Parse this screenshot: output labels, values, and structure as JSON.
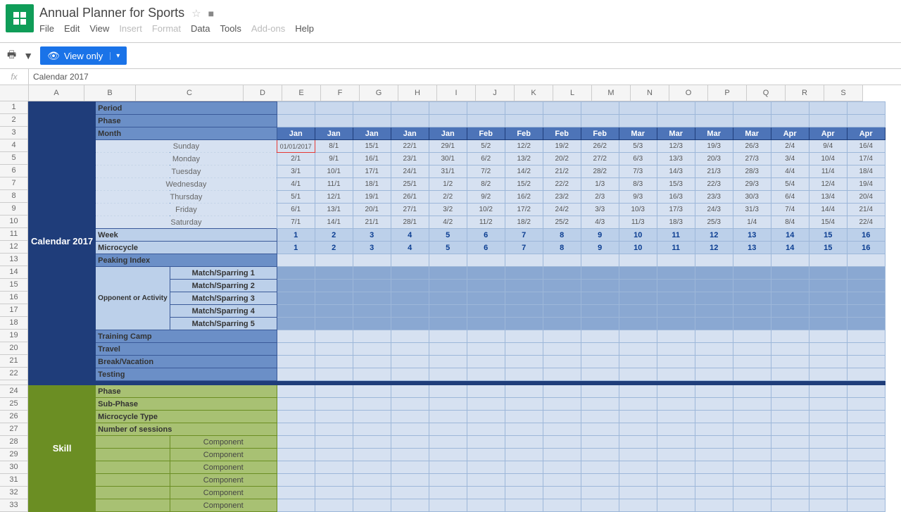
{
  "doc": {
    "title": "Annual Planner for Sports"
  },
  "menus": {
    "file": "File",
    "edit": "Edit",
    "view": "View",
    "insert": "Insert",
    "format": "Format",
    "data": "Data",
    "tools": "Tools",
    "addons": "Add-ons",
    "help": "Help"
  },
  "toolbar": {
    "view_only": "View only"
  },
  "fx": {
    "value": "Calendar 2017"
  },
  "cols": [
    "A",
    "B",
    "C",
    "D",
    "E",
    "F",
    "G",
    "H",
    "I",
    "J",
    "K",
    "L",
    "M",
    "N",
    "O",
    "P",
    "Q",
    "R",
    "S"
  ],
  "colWidths": [
    "wA",
    "wB",
    "wC",
    "wD",
    "wD",
    "wD",
    "wD",
    "wD",
    "wD",
    "wD",
    "wD",
    "wD",
    "wD",
    "wD",
    "wD",
    "wD",
    "wD",
    "wD",
    "wD"
  ],
  "rows": [
    "1",
    "2",
    "3",
    "4",
    "5",
    "6",
    "7",
    "8",
    "9",
    "10",
    "11",
    "12",
    "13",
    "14",
    "15",
    "16",
    "17",
    "18",
    "19",
    "20",
    "21",
    "22",
    "",
    "24",
    "25",
    "26",
    "27",
    "28",
    "29",
    "30",
    "31",
    "32",
    "33"
  ],
  "labels": {
    "calendar": "Calendar 2017",
    "period": "Period",
    "phase": "Phase",
    "month": "Month",
    "days": [
      "Sunday",
      "Monday",
      "Tuesday",
      "Wednesday",
      "Thursday",
      "Friday",
      "Saturday"
    ],
    "week": "Week",
    "microcycle": "Microcycle",
    "peaking": "Peaking Index",
    "opponent": "Opponent or Activity",
    "matches": [
      "Match/Sparring 1",
      "Match/Sparring 2",
      "Match/Sparring 3",
      "Match/Sparring 4",
      "Match/Sparring 5"
    ],
    "training": "Training Camp",
    "travel": "Travel",
    "break": "Break/Vacation",
    "testing": "Testing",
    "skill": "Skill",
    "subphase": "Sub-Phase",
    "microtype": "Microcycle Type",
    "sessions": "Number of sessions",
    "component": "Component"
  },
  "months": [
    "Jan",
    "Jan",
    "Jan",
    "Jan",
    "Jan",
    "Feb",
    "Feb",
    "Feb",
    "Feb",
    "Mar",
    "Mar",
    "Mar",
    "Mar",
    "Apr",
    "Apr",
    "Apr"
  ],
  "dates": [
    [
      "01/01/2017",
      "8/1",
      "15/1",
      "22/1",
      "29/1",
      "5/2",
      "12/2",
      "19/2",
      "26/2",
      "5/3",
      "12/3",
      "19/3",
      "26/3",
      "2/4",
      "9/4",
      "16/4"
    ],
    [
      "2/1",
      "9/1",
      "16/1",
      "23/1",
      "30/1",
      "6/2",
      "13/2",
      "20/2",
      "27/2",
      "6/3",
      "13/3",
      "20/3",
      "27/3",
      "3/4",
      "10/4",
      "17/4"
    ],
    [
      "3/1",
      "10/1",
      "17/1",
      "24/1",
      "31/1",
      "7/2",
      "14/2",
      "21/2",
      "28/2",
      "7/3",
      "14/3",
      "21/3",
      "28/3",
      "4/4",
      "11/4",
      "18/4"
    ],
    [
      "4/1",
      "11/1",
      "18/1",
      "25/1",
      "1/2",
      "8/2",
      "15/2",
      "22/2",
      "1/3",
      "8/3",
      "15/3",
      "22/3",
      "29/3",
      "5/4",
      "12/4",
      "19/4"
    ],
    [
      "5/1",
      "12/1",
      "19/1",
      "26/1",
      "2/2",
      "9/2",
      "16/2",
      "23/2",
      "2/3",
      "9/3",
      "16/3",
      "23/3",
      "30/3",
      "6/4",
      "13/4",
      "20/4"
    ],
    [
      "6/1",
      "13/1",
      "20/1",
      "27/1",
      "3/2",
      "10/2",
      "17/2",
      "24/2",
      "3/3",
      "10/3",
      "17/3",
      "24/3",
      "31/3",
      "7/4",
      "14/4",
      "21/4"
    ],
    [
      "7/1",
      "14/1",
      "21/1",
      "28/1",
      "4/2",
      "11/2",
      "18/2",
      "25/2",
      "4/3",
      "11/3",
      "18/3",
      "25/3",
      "1/4",
      "8/4",
      "15/4",
      "22/4"
    ]
  ],
  "weeks": [
    "1",
    "2",
    "3",
    "4",
    "5",
    "6",
    "7",
    "8",
    "9",
    "10",
    "11",
    "12",
    "13",
    "14",
    "15",
    "16"
  ]
}
